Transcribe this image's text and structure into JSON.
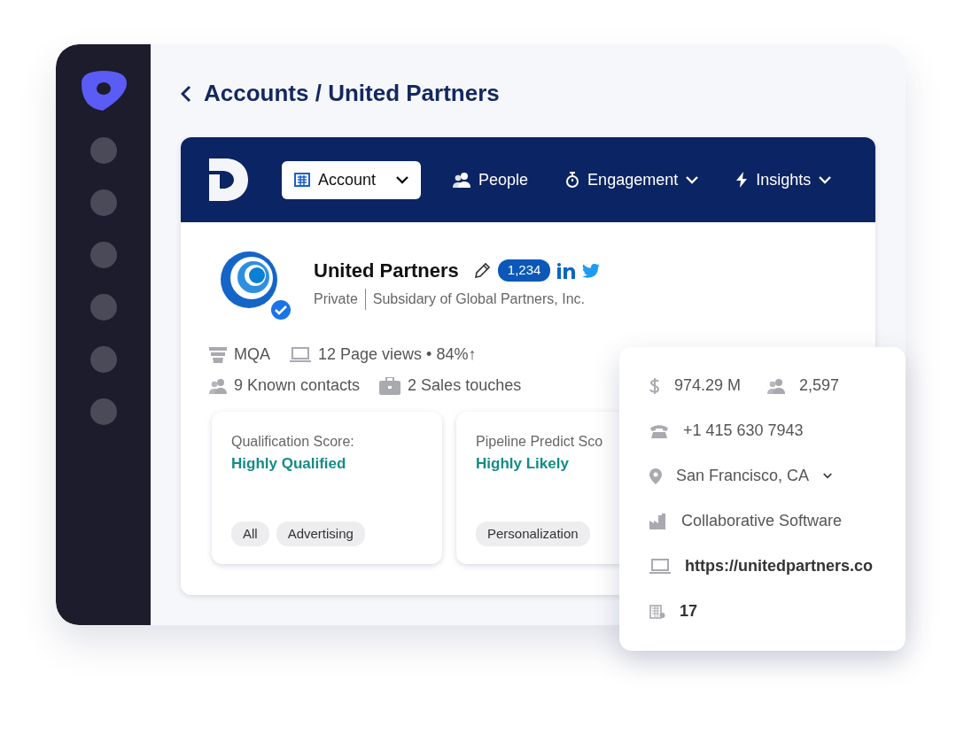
{
  "breadcrumb": "Accounts / United Partners",
  "nav": [
    {
      "label": "Account",
      "kind": "building",
      "selected": true,
      "dropdown": true
    },
    {
      "label": "People",
      "kind": "people",
      "selected": false,
      "dropdown": false
    },
    {
      "label": "Engagement",
      "kind": "stopwatch",
      "selected": false,
      "dropdown": true
    },
    {
      "label": "Insights",
      "kind": "bolt",
      "selected": false,
      "dropdown": true
    }
  ],
  "company": {
    "name": "United Partners",
    "count": "1,234",
    "verified": true,
    "ownership": "Private",
    "parent": "Subsidary of Global Partners, Inc."
  },
  "stats": [
    [
      {
        "kind": "funnel",
        "text": "MQA"
      },
      {
        "kind": "laptop",
        "text": "12 Page views • 84%↑"
      }
    ],
    [
      {
        "kind": "people",
        "text": "9 Known contacts"
      },
      {
        "kind": "briefcase",
        "text": "2 Sales touches"
      }
    ]
  ],
  "score_cards": [
    {
      "label": "Qualification Score:",
      "value": "Highly Qualified",
      "tags": [
        "All",
        "Advertising"
      ]
    },
    {
      "label": "Pipeline Predict Sco",
      "value": "Highly Likely",
      "tags": [
        "Personalization"
      ]
    }
  ],
  "details": [
    [
      {
        "kind": "dollar",
        "text": "974.29 M",
        "bold": false
      },
      {
        "kind": "people",
        "text": "2,597",
        "bold": false
      }
    ],
    [
      {
        "kind": "phone",
        "text": "+1 415 630 7943",
        "bold": false
      }
    ],
    [
      {
        "kind": "pin",
        "text": "San Francisco, CA",
        "bold": false,
        "dropdown": true
      }
    ],
    [
      {
        "kind": "factory",
        "text": "Collaborative Software",
        "bold": false
      }
    ],
    [
      {
        "kind": "laptop",
        "text": "https://unitedpartners.co",
        "bold": true
      }
    ],
    [
      {
        "kind": "office",
        "text": "17",
        "bold": true
      }
    ]
  ]
}
